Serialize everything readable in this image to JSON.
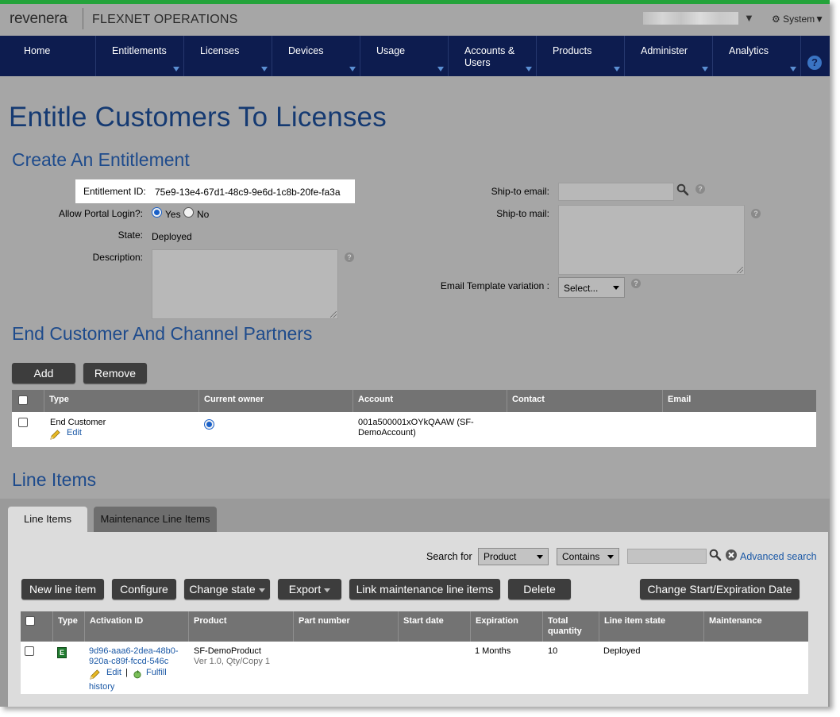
{
  "brand": {
    "logo_text": "revenera",
    "product": "FLEXNET OPERATIONS",
    "system_label": "System"
  },
  "nav": {
    "items": [
      {
        "label": "Home",
        "caret": false
      },
      {
        "label": "Entitlements",
        "caret": true
      },
      {
        "label": "Licenses",
        "caret": true
      },
      {
        "label": "Devices",
        "caret": true
      },
      {
        "label": "Usage",
        "caret": true
      },
      {
        "label": "Accounts &\nUsers",
        "caret": true
      },
      {
        "label": "Products",
        "caret": true
      },
      {
        "label": "Administer",
        "caret": true
      },
      {
        "label": "Analytics",
        "caret": true
      }
    ],
    "help": "?"
  },
  "page": {
    "title": "Entitle Customers To Licenses"
  },
  "create": {
    "section_title": "Create An Entitlement",
    "entitlement_id_label": "Entitlement ID:",
    "entitlement_id_value": "75e9-13e4-67d1-48c9-9e6d-1c8b-20fe-fa3a",
    "portal_login_label": "Allow Portal Login?:",
    "yes_label": "Yes",
    "no_label": "No",
    "portal_login_selected": "Yes",
    "state_label": "State:",
    "state_value": "Deployed",
    "description_label": "Description:",
    "description_value": "",
    "ship_email_label": "Ship-to email:",
    "ship_email_value": "",
    "ship_mail_label": "Ship-to mail:",
    "ship_mail_value": "",
    "email_template_label": "Email Template variation :",
    "email_template_value": "Select..."
  },
  "partners": {
    "section_title": "End Customer And Channel Partners",
    "add_label": "Add",
    "remove_label": "Remove",
    "columns": [
      "Type",
      "Current owner",
      "Account",
      "Contact",
      "Email"
    ],
    "rows": [
      {
        "type": "End Customer",
        "edit_label": "Edit",
        "current_owner": true,
        "account": "001a500001xOYkQAAW (SF-DemoAccount)",
        "contact": "",
        "email": ""
      }
    ]
  },
  "line_items": {
    "section_title": "Line Items",
    "tabs": [
      {
        "label": "Line Items",
        "active": true
      },
      {
        "label": "Maintenance Line Items",
        "active": false
      }
    ],
    "search_for_label": "Search for",
    "search_field_value": "Product",
    "search_operator_value": "Contains",
    "search_value": "",
    "advanced_search_label": "Advanced search",
    "buttons": {
      "new_line_item": "New line item",
      "configure": "Configure",
      "change_state": "Change state",
      "export": "Export",
      "link_maintenance": "Link maintenance line items",
      "delete": "Delete",
      "change_dates": "Change Start/Expiration Date"
    },
    "columns": [
      "Type",
      "Activation ID",
      "Product",
      "Part number",
      "Start date",
      "Expiration",
      "Total\nquantity",
      "Line item state",
      "Maintenance"
    ],
    "rows": [
      {
        "type_badge": "E",
        "activation_id": "9d96-aaa6-2dea-48b0-920a-c89f-fccd-546c",
        "edit_label": "Edit",
        "separator": "|",
        "fulfill_label": "Fulfill",
        "history_label": "history",
        "product": "SF-DemoProduct",
        "product_sub": "Ver 1.0, Qty/Copy 1",
        "part_number": "",
        "start_date": "",
        "expiration": "1 Months",
        "total_quantity": "10",
        "state": "Deployed",
        "maintenance": ""
      }
    ]
  },
  "colors": {
    "top_stripe": "#24a33b",
    "navbar": "#0d1c4f",
    "title_blue": "#153a72",
    "link_blue": "#1a58a6",
    "button_dark": "#3d3d3d"
  }
}
